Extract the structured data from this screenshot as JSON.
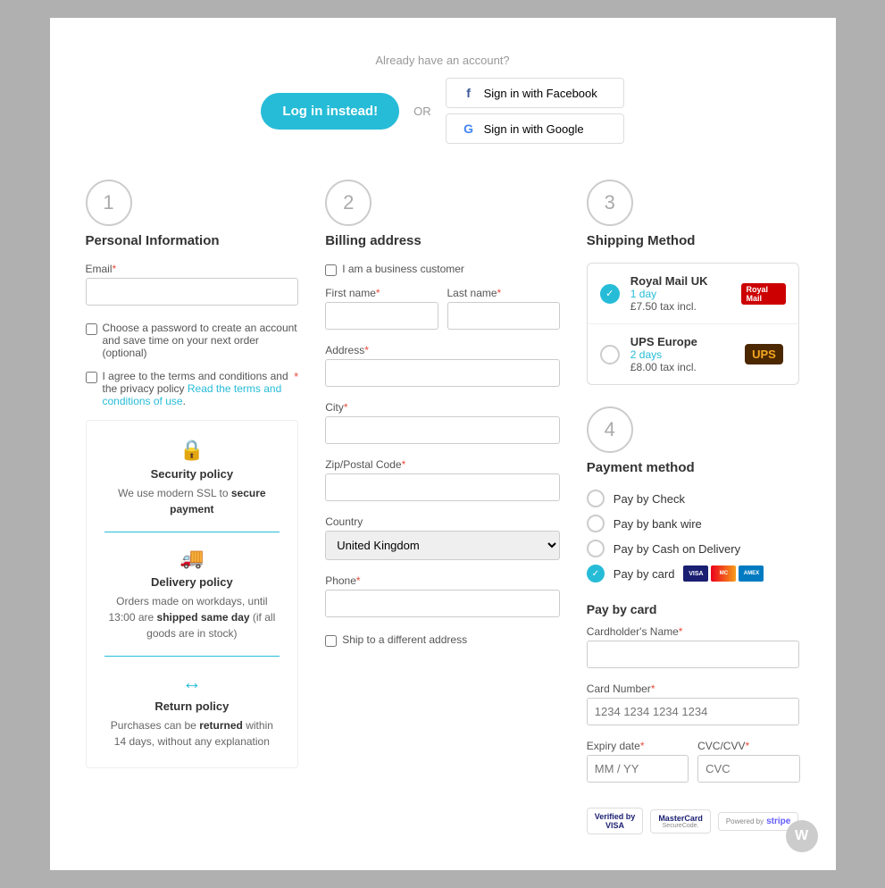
{
  "header": {
    "already_text": "Already have an account?",
    "login_btn": "Log in instead!",
    "or_text": "OR",
    "facebook_btn": "Sign in with Facebook",
    "google_btn": "Sign in with Google"
  },
  "steps": {
    "step1": {
      "number": "1",
      "title": "Personal Information",
      "email_label": "Email",
      "email_required": "*",
      "password_checkbox": "Choose a password to create an account and save time on your next order (optional)",
      "terms_checkbox": "I agree to the terms and conditions and the privacy policy",
      "terms_link": "Read the terms and conditions of use",
      "terms_required": "*"
    },
    "step2": {
      "number": "2",
      "title": "Billing address",
      "business_checkbox": "I am a business customer",
      "first_name_label": "First name",
      "first_name_required": "*",
      "last_name_label": "Last name",
      "last_name_required": "*",
      "address_label": "Address",
      "address_required": "*",
      "city_label": "City",
      "city_required": "*",
      "zip_label": "Zip/Postal Code",
      "zip_required": "*",
      "country_label": "Country",
      "country_default": "United Kingdom",
      "phone_label": "Phone",
      "phone_required": "*",
      "ship_different_checkbox": "Ship to a different address"
    },
    "step3": {
      "number": "3",
      "title": "Shipping Method",
      "options": [
        {
          "name": "Royal Mail UK",
          "days": "1 day",
          "price": "£7.50 tax incl.",
          "logo_text": "Royal Mail",
          "selected": true
        },
        {
          "name": "UPS Europe",
          "days": "2 days",
          "price": "£8.00 tax incl.",
          "logo_text": "UPS",
          "selected": false
        }
      ]
    },
    "step4": {
      "number": "4",
      "title": "Payment method",
      "options": [
        {
          "label": "Pay by Check",
          "selected": false
        },
        {
          "label": "Pay by bank wire",
          "selected": false
        },
        {
          "label": "Pay by Cash on Delivery",
          "selected": false
        },
        {
          "label": "Pay by card",
          "selected": true
        }
      ],
      "card_section": {
        "title": "Pay by card",
        "cardholder_label": "Cardholder's Name",
        "cardholder_required": "*",
        "card_number_label": "Card Number",
        "card_number_required": "*",
        "card_number_placeholder": "1234 1234 1234 1234",
        "expiry_label": "Expiry date",
        "expiry_required": "*",
        "expiry_placeholder": "MM / YY",
        "cvc_label": "CVC/CVV",
        "cvc_required": "*",
        "cvc_placeholder": "CVC"
      }
    }
  },
  "policies": [
    {
      "icon": "🔒",
      "title": "Security policy",
      "text": "We use modern SSL to secure payment"
    },
    {
      "icon": "🚚",
      "title": "Delivery policy",
      "text": "Orders made on workdays, until 13:00 are shipped same day (if all goods are in stock)"
    },
    {
      "icon": "↔",
      "title": "Return policy",
      "text": "Purchases can be returned within 14 days, without any explanation"
    }
  ],
  "watermark": "W",
  "colors": {
    "accent": "#26bcd7",
    "error": "#e74c3c"
  }
}
